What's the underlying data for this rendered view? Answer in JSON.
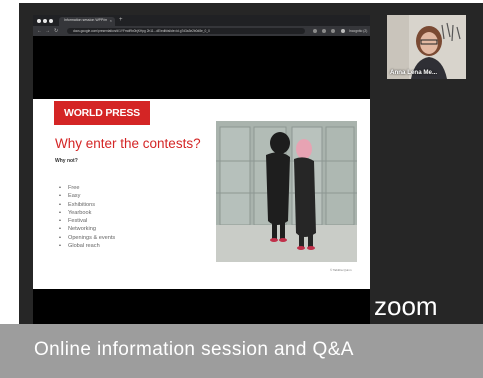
{
  "browser": {
    "tab_title": "Information session WPP/m",
    "tab_close": "×",
    "new_tab": "+",
    "nav_back": "←",
    "nav_forward": "→",
    "nav_reload": "↻",
    "url": "docs.google.com/presentation/d/1YFmdf9x0hjKHpg 2h11...dE/edit#slide=id.g7d3a3e2b0d8e_0_0",
    "profile_label": "Incognito (2)"
  },
  "slide": {
    "brand": "WORLD PRESS PHOTO",
    "title": "Why enter the contests?",
    "subtitle": "Why not?",
    "bullets": [
      "Free",
      "Easy",
      "Exhibitions",
      "Yearbook",
      "Festival",
      "Networking",
      "Openings & events",
      "Global reach"
    ],
    "photo_credit": "© Tabitha Quinn"
  },
  "participant": {
    "name": "Anna Lena Me..."
  },
  "zoom_logo": "zoom",
  "caption": "Online information session and Q&A",
  "colors": {
    "brand_red": "#d42525",
    "frame_bg": "#262626",
    "caption_bg": "#9d9d9d"
  }
}
